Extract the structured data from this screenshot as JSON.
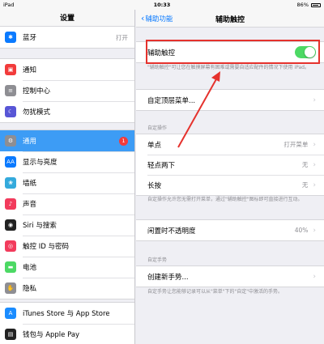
{
  "status": {
    "device": "iPad",
    "time": "10:33",
    "battery": "86%"
  },
  "sidebar": {
    "title": "设置",
    "groups": [
      [
        {
          "label": "蓝牙",
          "value": "打开",
          "icon": "bluetooth-icon",
          "color": "#0a7aff"
        }
      ],
      [
        {
          "label": "通知",
          "icon": "notifications-icon",
          "color": "#f23b3b"
        },
        {
          "label": "控制中心",
          "icon": "control-center-icon",
          "color": "#8e8e93"
        },
        {
          "label": "勿扰模式",
          "icon": "moon-icon",
          "color": "#5856d6"
        }
      ],
      [
        {
          "label": "通用",
          "badge": "1",
          "icon": "gear-icon",
          "color": "#8e8e93"
        },
        {
          "label": "显示与亮度",
          "icon": "display-icon",
          "color": "#0a7aff"
        },
        {
          "label": "墙纸",
          "icon": "wallpaper-icon",
          "color": "#34aadc"
        },
        {
          "label": "声音",
          "icon": "sound-icon",
          "color": "#f23b5c"
        },
        {
          "label": "Siri 与搜索",
          "icon": "siri-icon",
          "color": "#222222"
        },
        {
          "label": "触控 ID 与密码",
          "icon": "fingerprint-icon",
          "color": "#f23b5c"
        },
        {
          "label": "电池",
          "icon": "battery-icon",
          "color": "#4cd964"
        },
        {
          "label": "隐私",
          "icon": "hand-icon",
          "color": "#8e8e93"
        }
      ],
      [
        {
          "label": "iTunes Store 与 App Store",
          "icon": "app-store-icon",
          "color": "#1a8cff"
        },
        {
          "label": "钱包与 Apple Pay",
          "icon": "wallet-icon",
          "color": "#222222"
        }
      ]
    ]
  },
  "main": {
    "back_label": "辅助功能",
    "title": "辅助触控",
    "toggle_row": {
      "label": "辅助触控",
      "on": true
    },
    "toggle_footer": "\"辅助触控\"可让您在触摸屏幕有困难或需要自适应配件的情况下使用 iPad。",
    "top_menu": {
      "label": "自定顶层菜单..."
    },
    "custom_actions_header": "自定操作",
    "actions": [
      {
        "label": "单点",
        "value": "打开菜单"
      },
      {
        "label": "轻点两下",
        "value": "无"
      },
      {
        "label": "长按",
        "value": "无"
      }
    ],
    "actions_footer": "自定操作允许您无需打开菜单，通过\"辅助触控\"图标即可直接进行互动。",
    "opacity": {
      "label": "闲置时不透明度",
      "value": "40%"
    },
    "gestures_header": "自定手势",
    "create_gesture": {
      "label": "创建新手势..."
    },
    "gestures_footer": "自定手势让您能够记录可以从\"菜单\"下的\"自定\"中激活的手势。"
  },
  "colors": {
    "accent": "#0a7aff",
    "selected": "#3d9cf5",
    "toggle_on": "#4cd964",
    "annotation": "#e5322d"
  }
}
